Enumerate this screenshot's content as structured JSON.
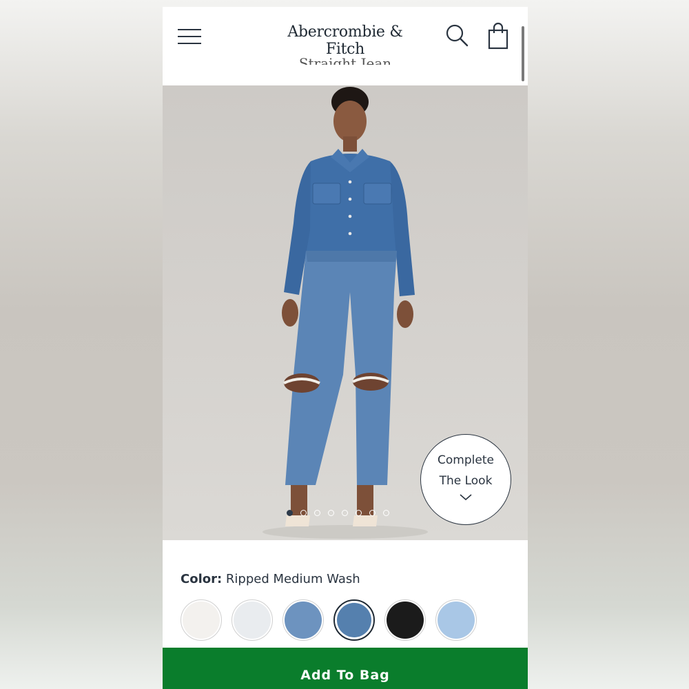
{
  "header": {
    "brand": "Abercrombie & Fitch",
    "product_title_peek": "Straight Jean",
    "icons": [
      "menu-icon",
      "search-icon",
      "shopping-bag-icon"
    ]
  },
  "carousel": {
    "image_alt": "Model wearing denim shirt and ripped straight jeans",
    "dot_count": 8,
    "active_index": 0
  },
  "complete_look": {
    "line1": "Complete",
    "line2": "The Look",
    "icon": "chevron-down-icon"
  },
  "color": {
    "label": "Color:",
    "value": "Ripped Medium Wash",
    "swatches": [
      {
        "name": "white",
        "color": "#f3f1ee"
      },
      {
        "name": "light-grey",
        "color": "#e9ecef"
      },
      {
        "name": "ripped-medium-light-wash",
        "color": "#6d93bf"
      },
      {
        "name": "ripped-medium-wash",
        "color": "#5580ae"
      },
      {
        "name": "black",
        "color": "#1b1b1b"
      },
      {
        "name": "light-wash",
        "color": "#a9c7e6"
      }
    ],
    "selected_index": 3
  },
  "cta": {
    "label": "Add To Bag",
    "color": "#0a7d2c"
  }
}
